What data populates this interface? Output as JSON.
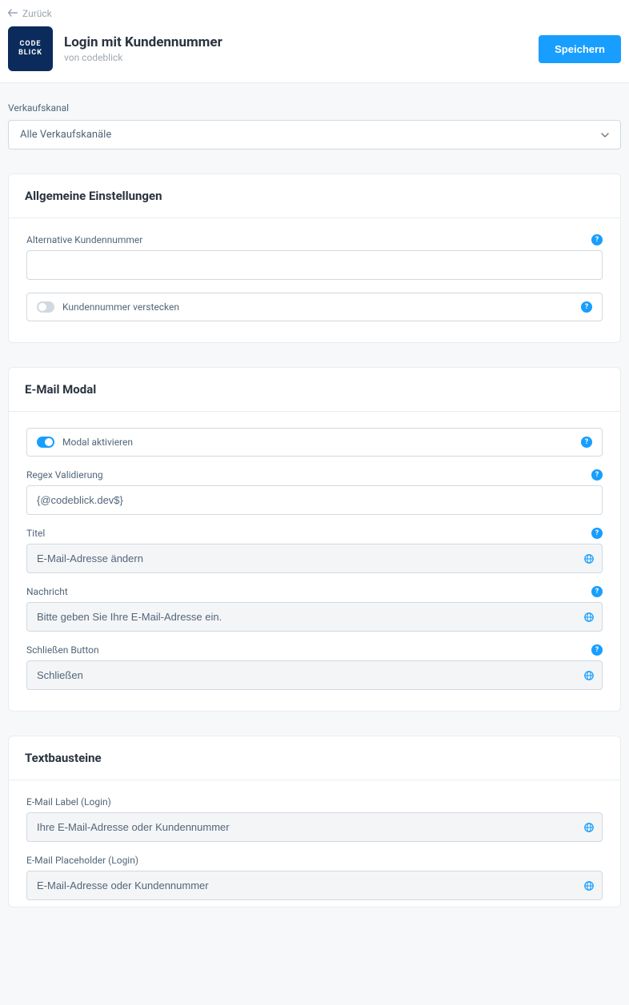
{
  "header": {
    "back_label": "Zurück",
    "brand_tile": "CODE\nBLICK",
    "title": "Login mit Kundennummer",
    "subtitle": "von codeblick",
    "save_label": "Speichern"
  },
  "sales_channel": {
    "label": "Verkaufskanal",
    "selected": "Alle Verkaufskanäle"
  },
  "sections": {
    "general": {
      "title": "Allgemeine Einstellungen",
      "alt_customer_number": {
        "label": "Alternative Kundennummer",
        "value": ""
      },
      "hide_customer_number": {
        "label": "Kundennummer verstecken",
        "on": false
      }
    },
    "email_modal": {
      "title": "E-Mail Modal",
      "activate": {
        "label": "Modal aktivieren",
        "on": true
      },
      "regex": {
        "label": "Regex Validierung",
        "value": "{@codeblick.dev$}"
      },
      "titel": {
        "label": "Titel",
        "value": "E-Mail-Adresse ändern"
      },
      "nachricht": {
        "label": "Nachricht",
        "value": "Bitte geben Sie Ihre E-Mail-Adresse ein."
      },
      "close_btn": {
        "label": "Schließen Button",
        "value": "Schließen"
      }
    },
    "textbausteine": {
      "title": "Textbausteine",
      "email_label_login": {
        "label": "E-Mail Label (Login)",
        "value": "Ihre E-Mail-Adresse oder Kundennummer"
      },
      "email_placeholder_login": {
        "label": "E-Mail Placeholder (Login)",
        "value": "E-Mail-Adresse oder Kundennummer"
      }
    }
  },
  "icons": {
    "help": "?",
    "arrow_left": "←"
  }
}
